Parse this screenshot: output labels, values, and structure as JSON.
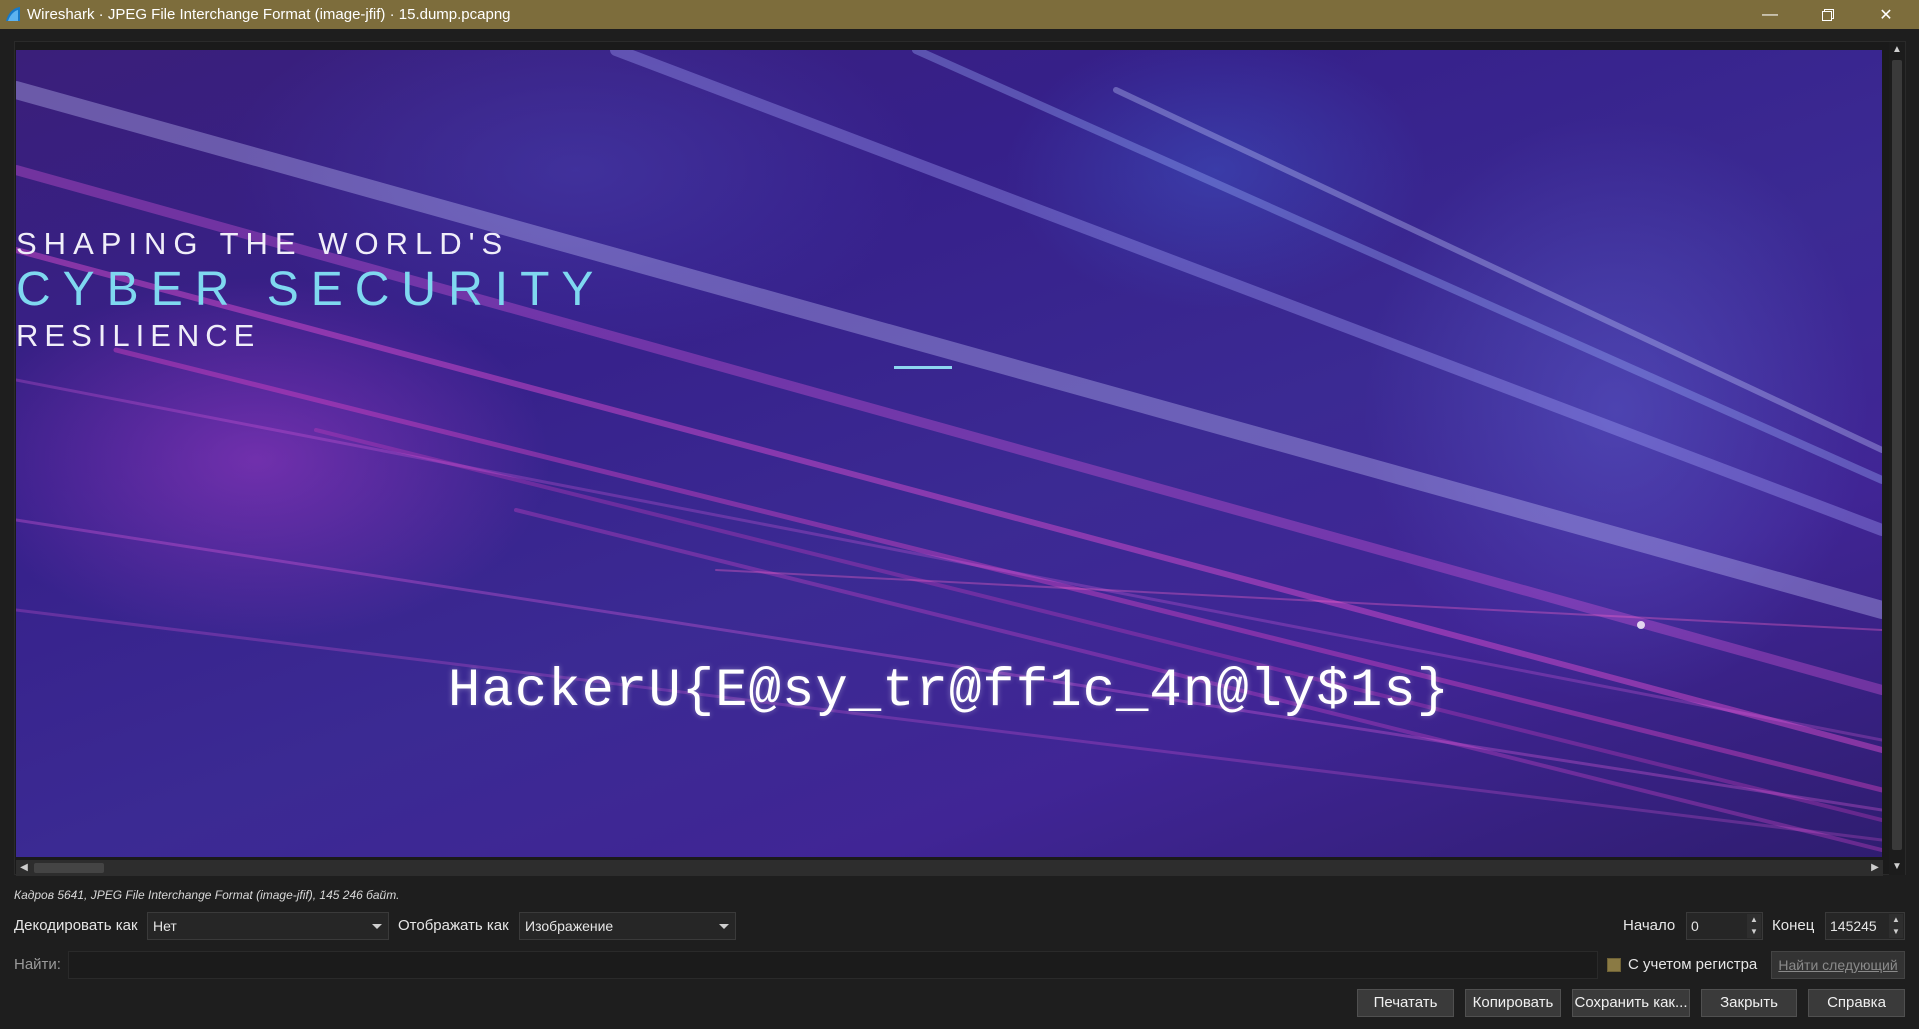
{
  "window": {
    "title": "Wireshark · JPEG File Interchange Format (image-jfif) · 15.dump.pcapng",
    "controls": [
      "minimize-icon",
      "restore-icon",
      "close-icon"
    ]
  },
  "image": {
    "line1": "SHAPING THE WORLD'S",
    "line2": "CYBER SECURITY",
    "line3": "RESILIENCE",
    "flag": "HackerU{E@sy_tr@ff1c_4n@ly$1s}"
  },
  "frame_info": "Кадров 5641, JPEG File Interchange Format (image-jfif), 145 246 байт.",
  "controls": {
    "decode_label": "Декодировать как",
    "decode_value": "Нет",
    "show_label": "Отображать как",
    "show_value": "Изображение",
    "start_label": "Начало",
    "start_value": "0",
    "end_label": "Конец",
    "end_value": "145245",
    "find_label": "Найти:",
    "case_label": "С учетом регистра",
    "find_next": "Найти следующий"
  },
  "buttons": {
    "print": "Печатать",
    "copy": "Копировать",
    "save_as": "Сохранить как...",
    "close": "Закрыть",
    "help": "Справка"
  },
  "colors": {
    "titlebar": "#7d6d3c",
    "background": "#1e1e1e",
    "accent_cyan": "#7fd8f0"
  }
}
